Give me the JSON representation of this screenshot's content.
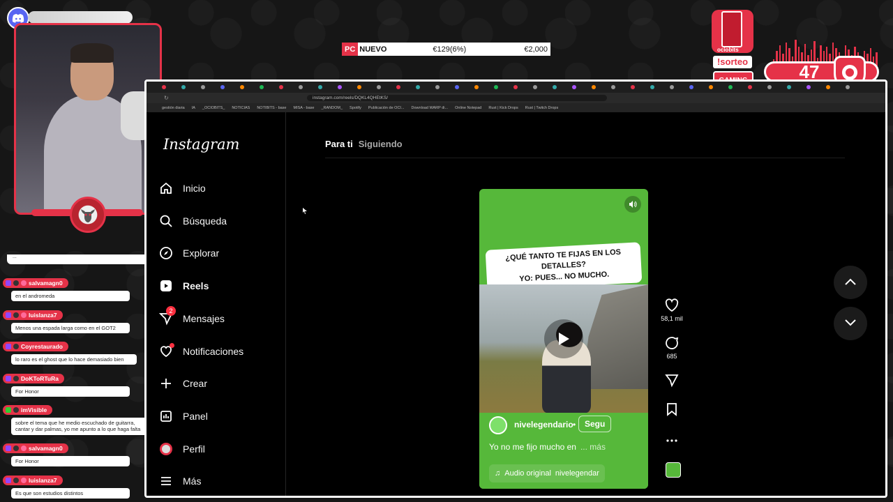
{
  "ticker": {
    "tag": "PC",
    "label": "NUEVO",
    "price_current": "€129(6%)",
    "price_original": "€2,000"
  },
  "overlay": {
    "brand": "ociobits",
    "sorteo": "!sorteo",
    "gaming": "GAMING",
    "counter": "47",
    "accent_color": "#e53248"
  },
  "browser": {
    "url": "instagram.com/reels/DQKL4QHEtKS/",
    "bookmarks": [
      "gestión diaria",
      "IA",
      "_OCIOBITS_",
      "NOTICIAS",
      "NOTIBITS - base",
      "MISA - base",
      "_RANDOM_",
      "Spotify",
      "Publicación de OCI...",
      "Download WARP di...",
      "Online Notepad",
      "Rust | Kick Drops",
      "Rust | Twitch Drops"
    ]
  },
  "sidebar": {
    "logo": "Instagram",
    "items": [
      {
        "label": "Inicio",
        "icon": "home-icon"
      },
      {
        "label": "Búsqueda",
        "icon": "search-icon"
      },
      {
        "label": "Explorar",
        "icon": "compass-icon"
      },
      {
        "label": "Reels",
        "icon": "reels-icon"
      },
      {
        "label": "Mensajes",
        "icon": "messages-icon",
        "badge": "2"
      },
      {
        "label": "Notificaciones",
        "icon": "heart-icon"
      },
      {
        "label": "Crear",
        "icon": "plus-icon"
      },
      {
        "label": "Panel",
        "icon": "dashboard-icon"
      },
      {
        "label": "Perfil",
        "icon": "profile-icon"
      },
      {
        "label": "Más",
        "icon": "menu-icon"
      }
    ]
  },
  "feed_tabs": {
    "active": "Para ti",
    "inactive": "Siguiendo"
  },
  "reel": {
    "overlay_text_line1": "¿QUÉ TANTO TE FIJAS EN LOS",
    "overlay_text_line2": "DETALLES?",
    "overlay_text_line3": "YO: PUES... NO MUCHO.",
    "username": "nivelegendario",
    "dot": "•",
    "follow": "Segu",
    "caption": "Yo no me fijo mucho en",
    "more": "... más",
    "audio_label": "Audio original",
    "audio_user": "nivelegendar"
  },
  "actions": {
    "likes": "58,1 mil",
    "comments": "685"
  },
  "chat": {
    "top_text": "...",
    "messages": [
      {
        "user": "salvamagn0",
        "text": "en el andromeda"
      },
      {
        "user": "luislanza7",
        "text": "Menos una espada larga como en el GOT2"
      },
      {
        "user": "Coyrestaurado",
        "text": "lo raro es el ghost que lo hace demasiado bien"
      },
      {
        "user": "DoKToRTuRa",
        "text": "For Honor"
      },
      {
        "user": "imVisible",
        "text": "sobre el tema que he medio escuchado de guitarra, cantar y dar palmas, yo me apunto a lo que haga falta"
      },
      {
        "user": "salvamagn0",
        "text": "For Honor"
      },
      {
        "user": "luislanza7",
        "text": "Es que son estudios distintos"
      }
    ]
  }
}
